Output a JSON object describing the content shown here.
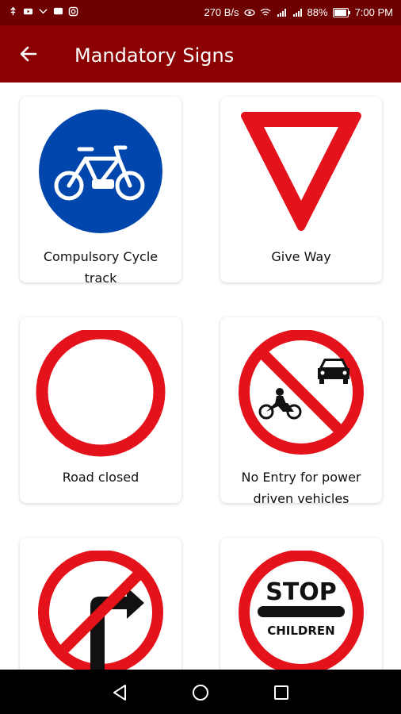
{
  "status_bar": {
    "speed": "270 B/s",
    "battery": "88%",
    "time": "7:00 PM"
  },
  "app_bar": {
    "title": "Mandatory Signs",
    "back_icon": "arrow-left-icon"
  },
  "signs": [
    {
      "label_line1": "Compulsory Cycle",
      "label_line2": "track",
      "icon": "cycle-track-sign"
    },
    {
      "label_line1": "Give Way",
      "label_line2": "",
      "icon": "give-way-sign"
    },
    {
      "label_line1": "Road closed",
      "label_line2": "",
      "icon": "road-closed-sign"
    },
    {
      "label_line1": "No Entry for power",
      "label_line2": "driven vehicles",
      "icon": "no-entry-power-vehicles-sign"
    },
    {
      "label_line1": "",
      "label_line2": "",
      "icon": "no-right-turn-sign"
    },
    {
      "label_line1": "",
      "label_line2": "",
      "icon": "stop-children-sign",
      "sign_text_top": "STOP",
      "sign_text_bottom": "CHILDREN"
    }
  ],
  "colors": {
    "status_bar": "#6e0000",
    "app_bar": "#8b0000",
    "sign_red": "#e3121b",
    "sign_blue": "#0046ad"
  },
  "nav_bar": {
    "back_icon": "triangle-back-icon",
    "home_icon": "circle-home-icon",
    "recents_icon": "square-recents-icon"
  }
}
